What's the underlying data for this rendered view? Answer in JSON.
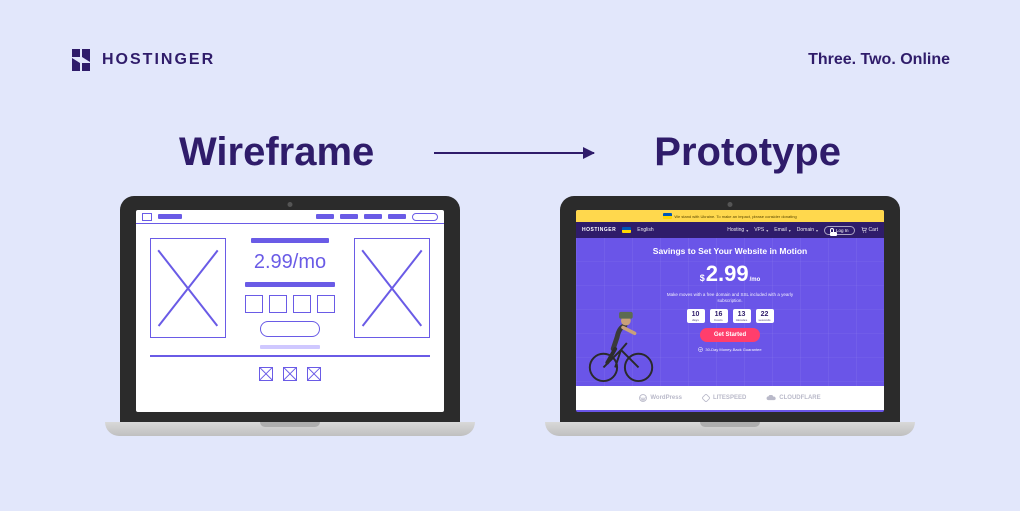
{
  "brand": {
    "name": "HOSTINGER",
    "tagline": "Three. Two. Online"
  },
  "headings": {
    "left": "Wireframe",
    "right": "Prototype"
  },
  "wireframe": {
    "price": "2.99/mo"
  },
  "prototype": {
    "banner": "We stand with Ukraine. To make an impact, please consider donating",
    "brand": "HOSTINGER",
    "lang": "English",
    "nav": {
      "hosting": "Hosting",
      "vps": "VPS",
      "email": "Email",
      "domain": "Domain"
    },
    "login": "Log In",
    "cart": "Cart",
    "hero": {
      "title": "Savings to Set Your Website in Motion",
      "currency": "$",
      "price_main": "2.99",
      "price_suffix": "/mo",
      "subhead": "Make moves with a free domain and SSL included with a yearly subscription.",
      "countdown": [
        {
          "num": "10",
          "lab": "days"
        },
        {
          "num": "16",
          "lab": "hours"
        },
        {
          "num": "13",
          "lab": "minutes"
        },
        {
          "num": "22",
          "lab": "seconds"
        }
      ],
      "cta": "Get Started",
      "guarantee": "30-Day Money-Back Guarantee"
    },
    "logos": {
      "a": "WordPress",
      "b": "LITESPEED",
      "c": "CLOUDFLARE"
    }
  },
  "colors": {
    "bg": "#e2e7fb",
    "ink": "#2f1c6a",
    "accent": "#6a55e8",
    "cta": "#ff3e6c"
  }
}
